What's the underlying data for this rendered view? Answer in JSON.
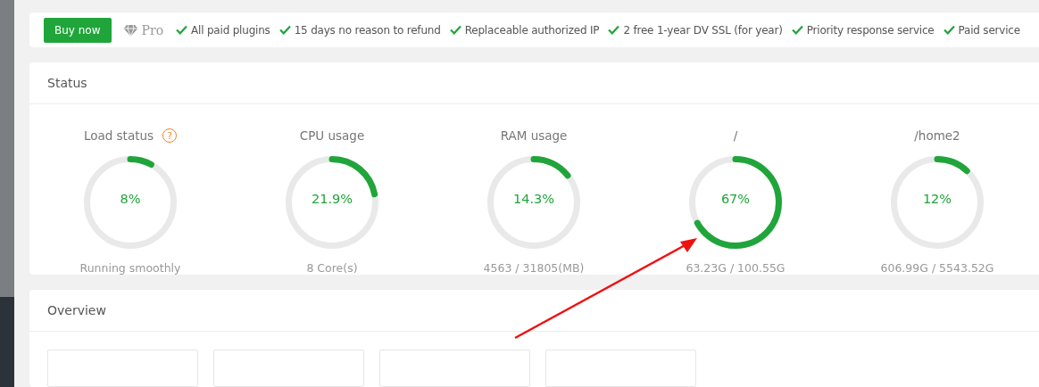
{
  "promo": {
    "button": "Buy now",
    "edition": "Pro",
    "features": [
      "All paid plugins",
      "15 days no reason to refund",
      "Replaceable authorized IP",
      "2 free 1-year DV SSL (for year)",
      "Priority response service",
      "Paid service"
    ]
  },
  "status": {
    "title": "Status",
    "gauges": [
      {
        "title": "Load status",
        "help": "?",
        "value": "8%",
        "level": 0.08,
        "caption": "Running smoothly"
      },
      {
        "title": "CPU usage",
        "value": "21.9%",
        "level": 0.219,
        "caption": "8 Core(s)"
      },
      {
        "title": "RAM usage",
        "value": "14.3%",
        "level": 0.143,
        "caption": "4563 / 31805(MB)"
      },
      {
        "title": "/",
        "value": "67%",
        "level": 0.67,
        "caption": "63.23G / 100.55G"
      },
      {
        "title": "/home2",
        "value": "12%",
        "level": 0.12,
        "caption": "606.99G / 5543.52G"
      }
    ]
  },
  "overview": {
    "title": "Overview"
  }
}
